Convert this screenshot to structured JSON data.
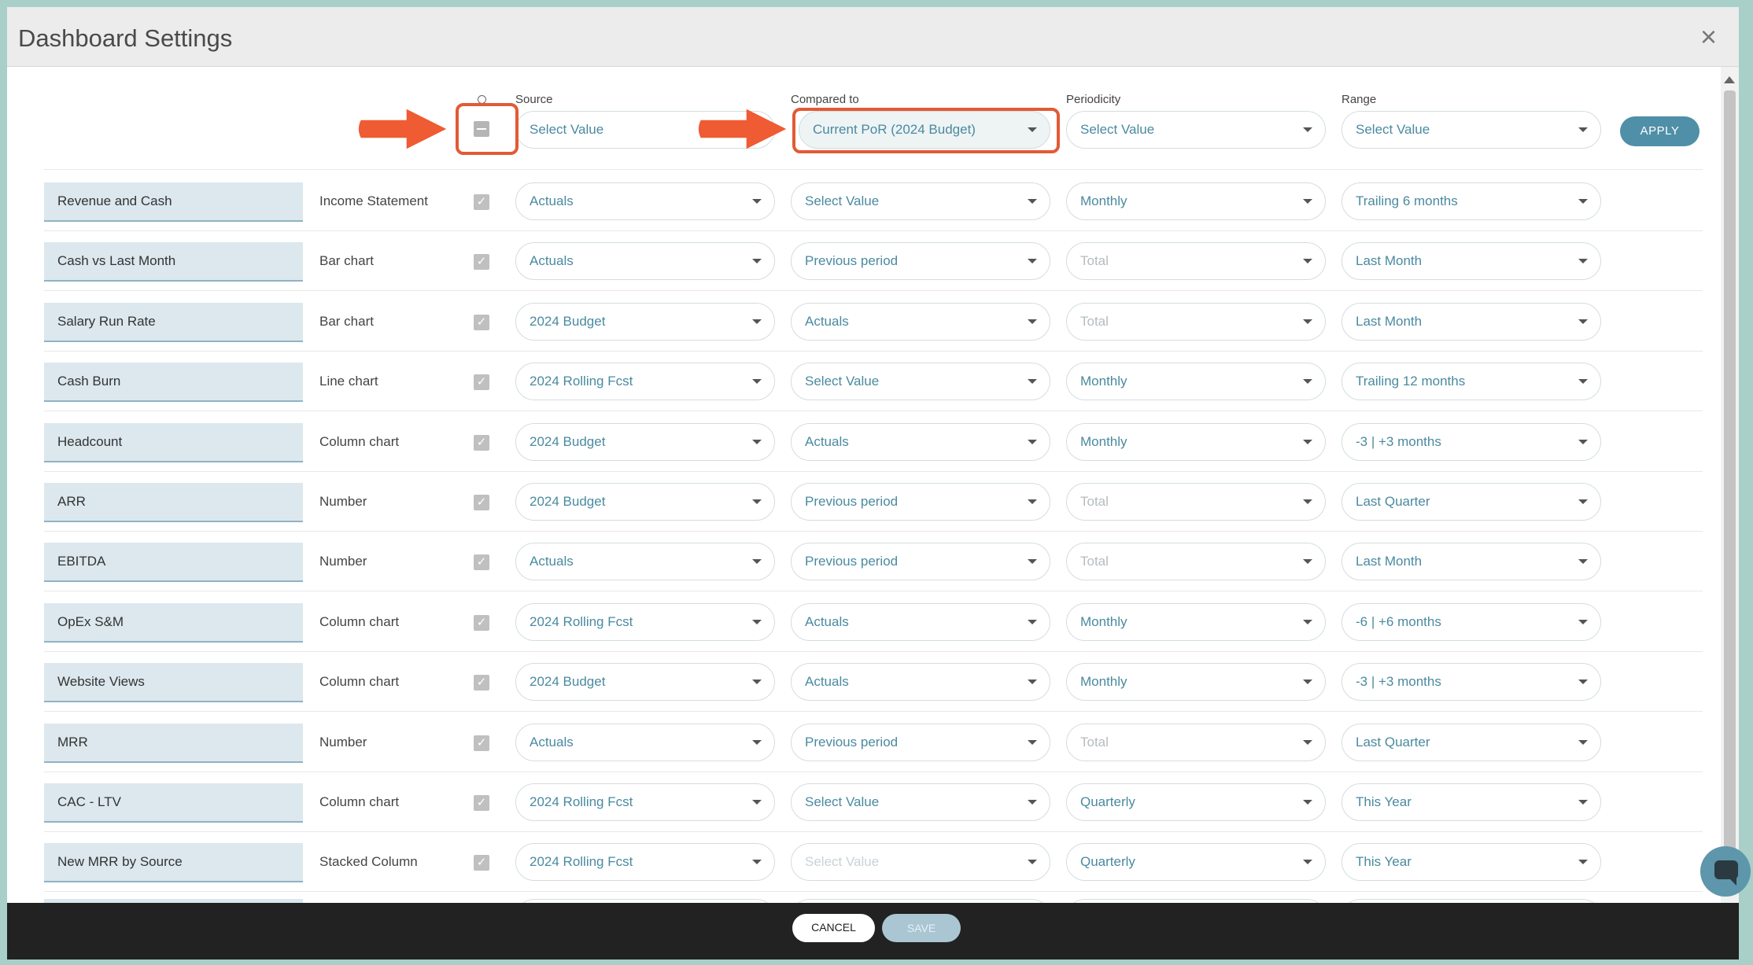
{
  "dialog": {
    "title": "Dashboard Settings",
    "close_label": "×"
  },
  "columns": {
    "source": "Source",
    "compared": "Compared to",
    "periodicity": "Periodicity",
    "range": "Range"
  },
  "bulk": {
    "source": "Select Value",
    "compared": "Current PoR (2024 Budget)",
    "periodicity": "Select Value",
    "range": "Select Value",
    "apply_label": "APPLY"
  },
  "rows": [
    {
      "name": "Revenue and Cash",
      "type": "Income Statement",
      "checked": "✓",
      "source": "Actuals",
      "compared": "Select Value",
      "periodicity": "Monthly",
      "range": "Trailing 6 months"
    },
    {
      "name": "Cash vs Last Month",
      "type": "Bar chart",
      "checked": "✓",
      "source": "Actuals",
      "compared": "Previous period",
      "periodicity": "Total",
      "range": "Last Month"
    },
    {
      "name": "Salary Run Rate",
      "type": "Bar chart",
      "checked": "✓",
      "source": "2024 Budget",
      "compared": "Actuals",
      "periodicity": "Total",
      "range": "Last Month"
    },
    {
      "name": "Cash Burn",
      "type": "Line chart",
      "checked": "✓",
      "source": "2024 Rolling Fcst",
      "compared": "Select Value",
      "periodicity": "Monthly",
      "range": "Trailing 12 months"
    },
    {
      "name": "Headcount",
      "type": "Column chart",
      "checked": "✓",
      "source": "2024 Budget",
      "compared": "Actuals",
      "periodicity": "Monthly",
      "range": "-3 | +3 months"
    },
    {
      "name": "ARR",
      "type": "Number",
      "checked": "✓",
      "source": "2024 Budget",
      "compared": "Previous period",
      "periodicity": "Total",
      "range": "Last Quarter"
    },
    {
      "name": "EBITDA",
      "type": "Number",
      "checked": "✓",
      "source": "Actuals",
      "compared": "Previous period",
      "periodicity": "Total",
      "range": "Last Month"
    },
    {
      "name": "OpEx S&M",
      "type": "Column chart",
      "checked": "✓",
      "source": "2024 Rolling Fcst",
      "compared": "Actuals",
      "periodicity": "Monthly",
      "range": "-6 | +6 months"
    },
    {
      "name": "Website Views",
      "type": "Column chart",
      "checked": "✓",
      "source": "2024 Budget",
      "compared": "Actuals",
      "periodicity": "Monthly",
      "range": "-3 | +3 months"
    },
    {
      "name": "MRR",
      "type": "Number",
      "checked": "✓",
      "source": "Actuals",
      "compared": "Previous period",
      "periodicity": "Total",
      "range": "Last Quarter"
    },
    {
      "name": "CAC - LTV",
      "type": "Column chart",
      "checked": "✓",
      "source": "2024 Rolling Fcst",
      "compared": "Select Value",
      "periodicity": "Quarterly",
      "range": "This Year"
    },
    {
      "name": "New MRR by Source",
      "type": "Stacked Column",
      "checked": "✓",
      "source": "2024 Rolling Fcst",
      "compared": "Select Value",
      "periodicity": "Quarterly",
      "range": "This Year"
    }
  ],
  "footer": {
    "cancel_label": "CANCEL",
    "save_label": "SAVE"
  },
  "colors": {
    "accent": "#4f8fa8",
    "highlight": "#e25a35",
    "footer_bg": "#222222"
  }
}
